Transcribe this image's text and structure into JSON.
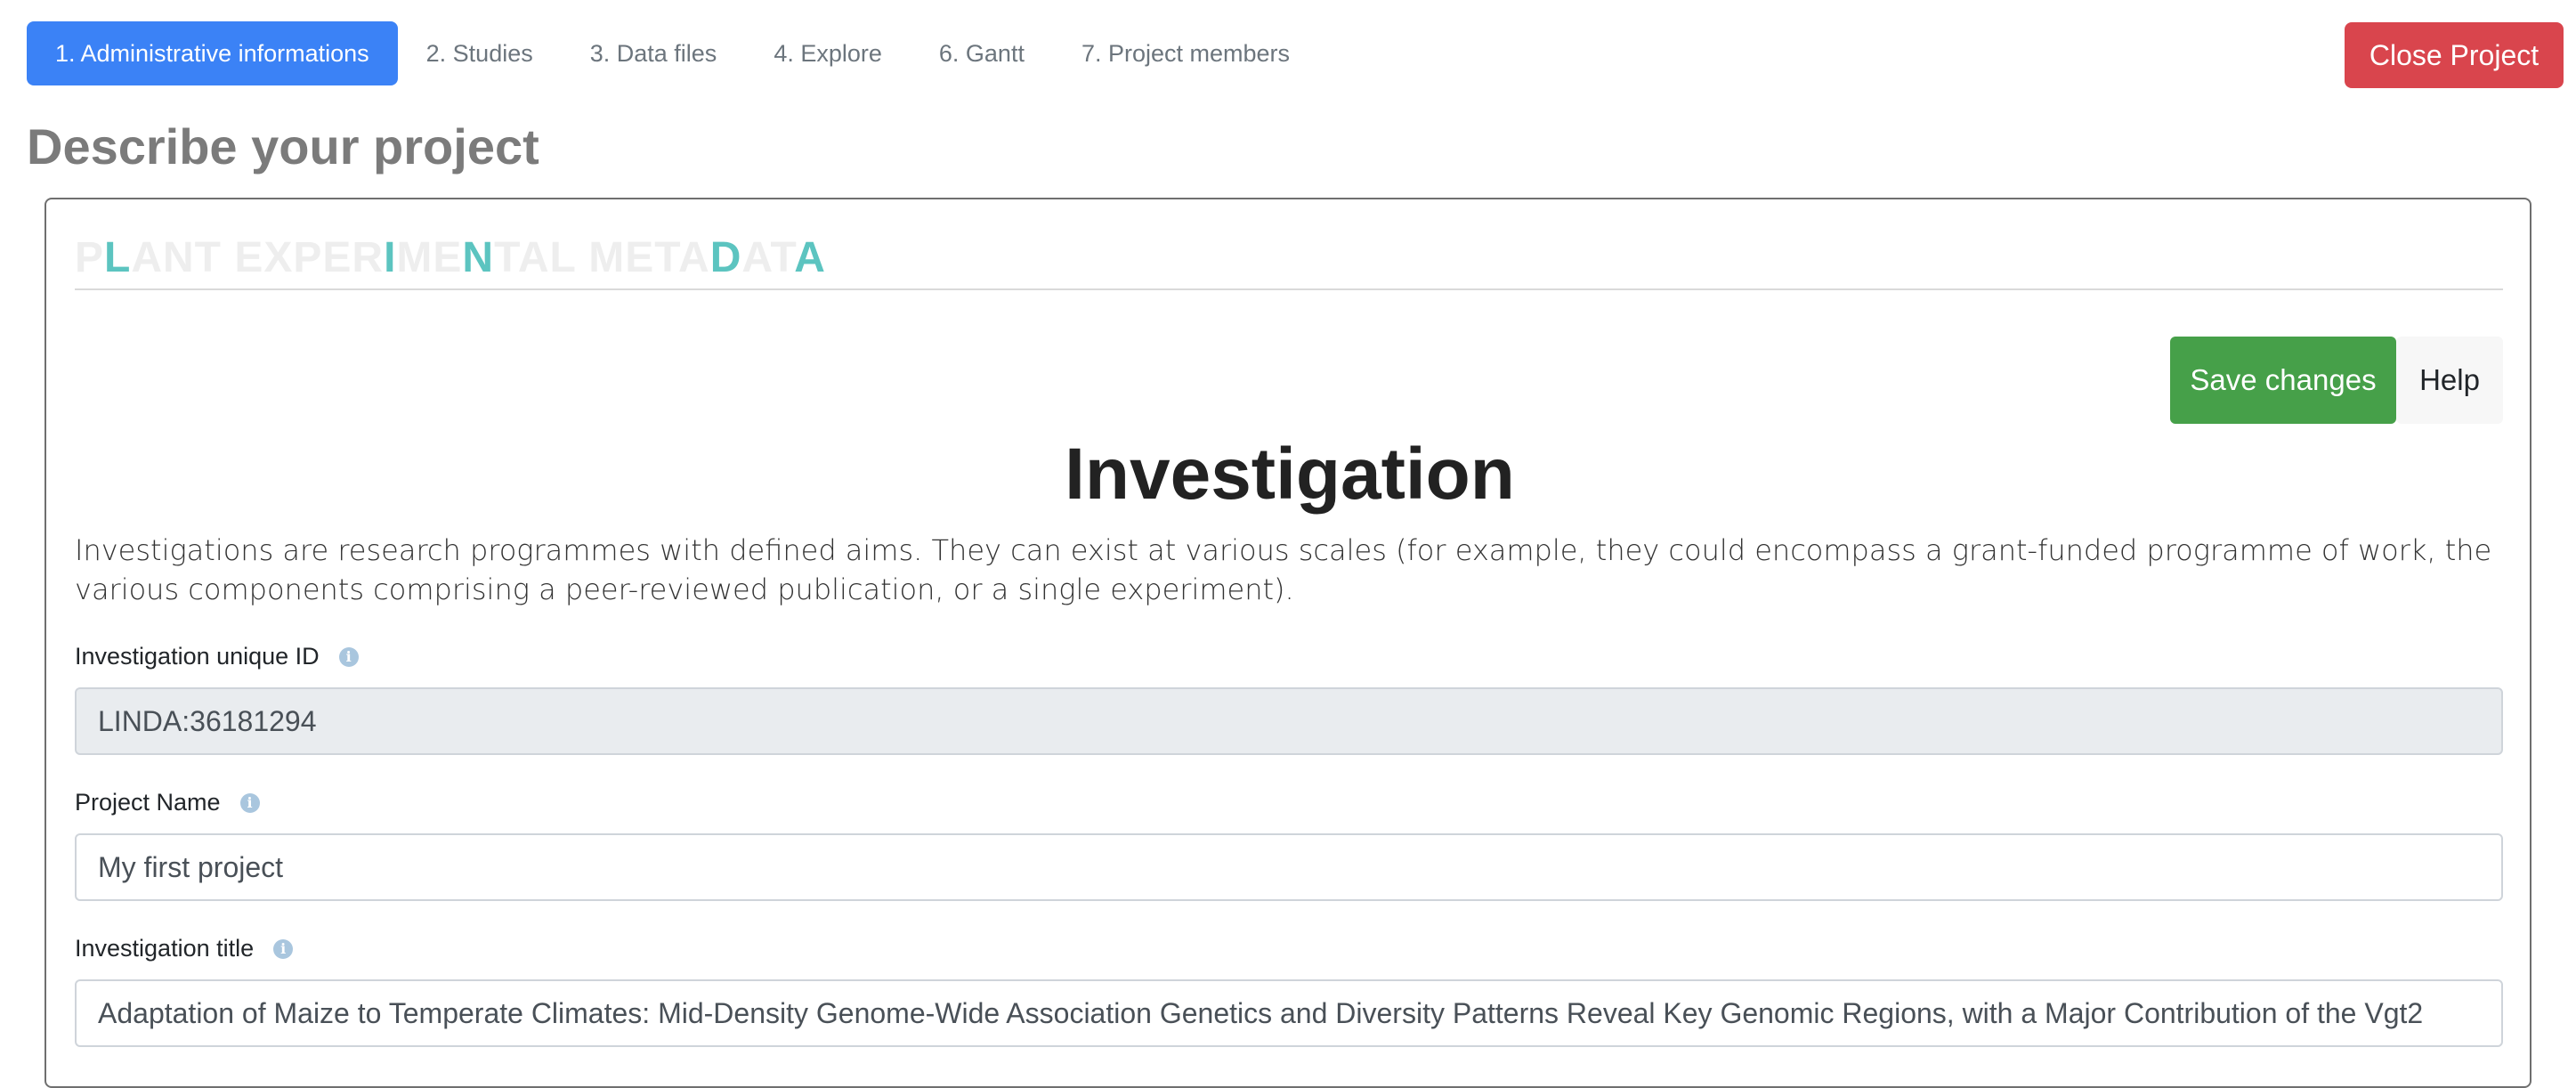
{
  "nav": {
    "tabs": [
      {
        "label": "1. Administrative informations",
        "active": true
      },
      {
        "label": "2. Studies",
        "active": false
      },
      {
        "label": "3. Data files",
        "active": false
      },
      {
        "label": "4. Explore",
        "active": false
      },
      {
        "label": "6. Gantt",
        "active": false
      },
      {
        "label": "7. Project members",
        "active": false
      }
    ],
    "close_label": "Close Project"
  },
  "page": {
    "heading": "Describe your project"
  },
  "logo": {
    "parts": [
      {
        "text": "P",
        "hl": false
      },
      {
        "text": "L",
        "hl": true
      },
      {
        "text": "ANT EXPER",
        "hl": false
      },
      {
        "text": "I",
        "hl": true
      },
      {
        "text": "ME",
        "hl": false
      },
      {
        "text": "N",
        "hl": true
      },
      {
        "text": "TAL META",
        "hl": false
      },
      {
        "text": "D",
        "hl": true
      },
      {
        "text": "AT",
        "hl": false
      },
      {
        "text": "A",
        "hl": true
      }
    ]
  },
  "toolbar": {
    "save_label": "Save changes",
    "help_label": "Help"
  },
  "investigation": {
    "title": "Investigation",
    "description": "Investigations are research programmes with defined aims. They can exist at various scales (for example, they could encompass a grant-funded programme of work, the various components comprising a peer-reviewed publication, or a single experiment).",
    "fields": {
      "unique_id": {
        "label": "Investigation unique ID",
        "value": "LINDA:36181294"
      },
      "project_name": {
        "label": "Project Name",
        "value": "My first project"
      },
      "title": {
        "label": "Investigation title",
        "value": "Adaptation of Maize to Temperate Climates: Mid-Density Genome-Wide Association Genetics and Diversity Patterns Reveal Key Genomic Regions, with a Major Contribution of the Vgt2"
      }
    }
  },
  "colors": {
    "primary": "#3b82f6",
    "danger": "#d9454d",
    "success": "#46a049",
    "logo_accent": "#5cc4c0"
  }
}
